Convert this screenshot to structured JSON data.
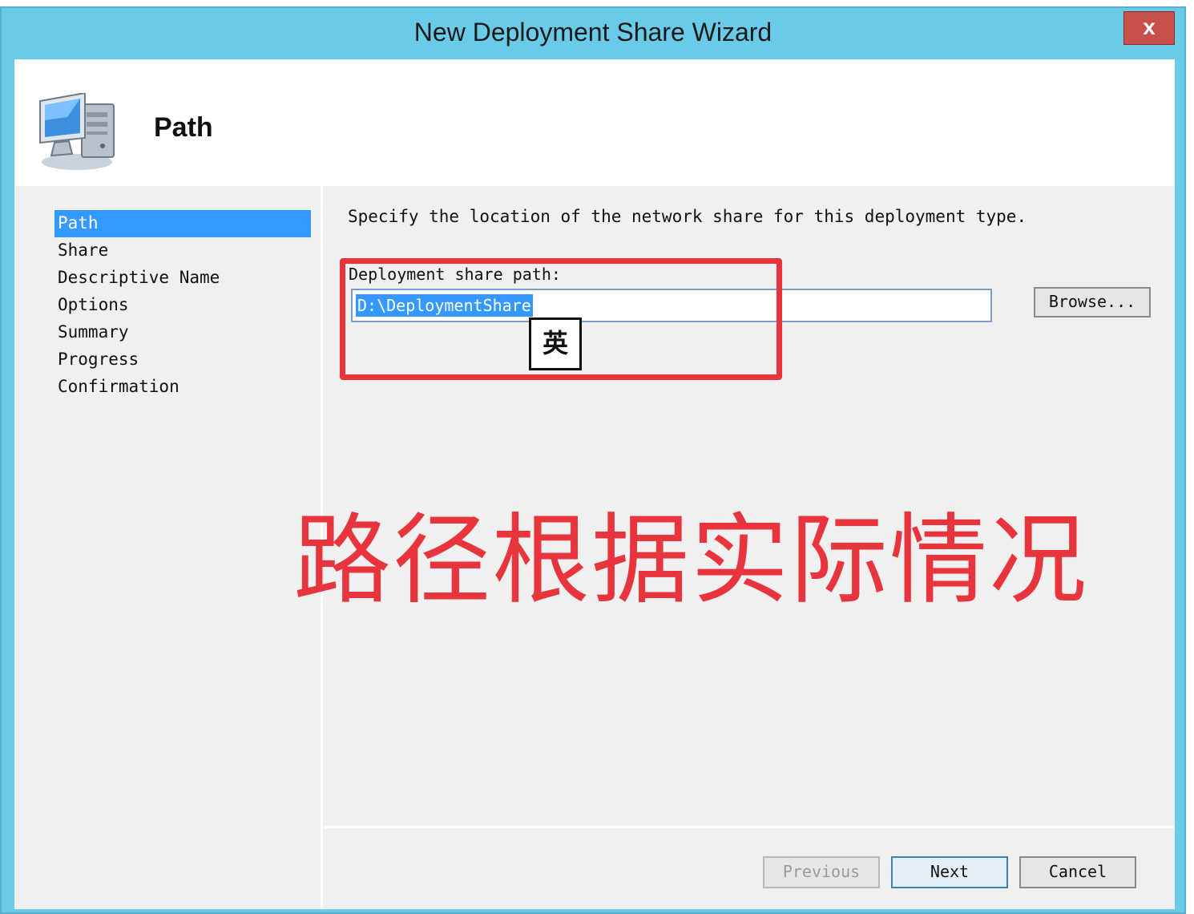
{
  "window": {
    "title": "New Deployment Share Wizard",
    "close_label": "x"
  },
  "header": {
    "title": "Path",
    "icon": "computer-icon"
  },
  "sidebar": {
    "steps": [
      {
        "label": "Path",
        "active": true
      },
      {
        "label": "Share",
        "active": false
      },
      {
        "label": "Descriptive Name",
        "active": false
      },
      {
        "label": "Options",
        "active": false
      },
      {
        "label": "Summary",
        "active": false
      },
      {
        "label": "Progress",
        "active": false
      },
      {
        "label": "Confirmation",
        "active": false
      }
    ]
  },
  "main": {
    "instruction": "Specify the location of the network share for this deployment type.",
    "path_label": "Deployment share path:",
    "path_value": "D:\\DeploymentShare",
    "browse_label": "Browse...",
    "ime_indicator": "英",
    "annotation": "路径根据实际情况"
  },
  "footer": {
    "previous_label": "Previous",
    "next_label": "Next",
    "cancel_label": "Cancel"
  },
  "colors": {
    "titlebar": "#6acbe8",
    "selection": "#3399ff",
    "annotation": "#e8343c",
    "close_button": "#c7504a"
  }
}
